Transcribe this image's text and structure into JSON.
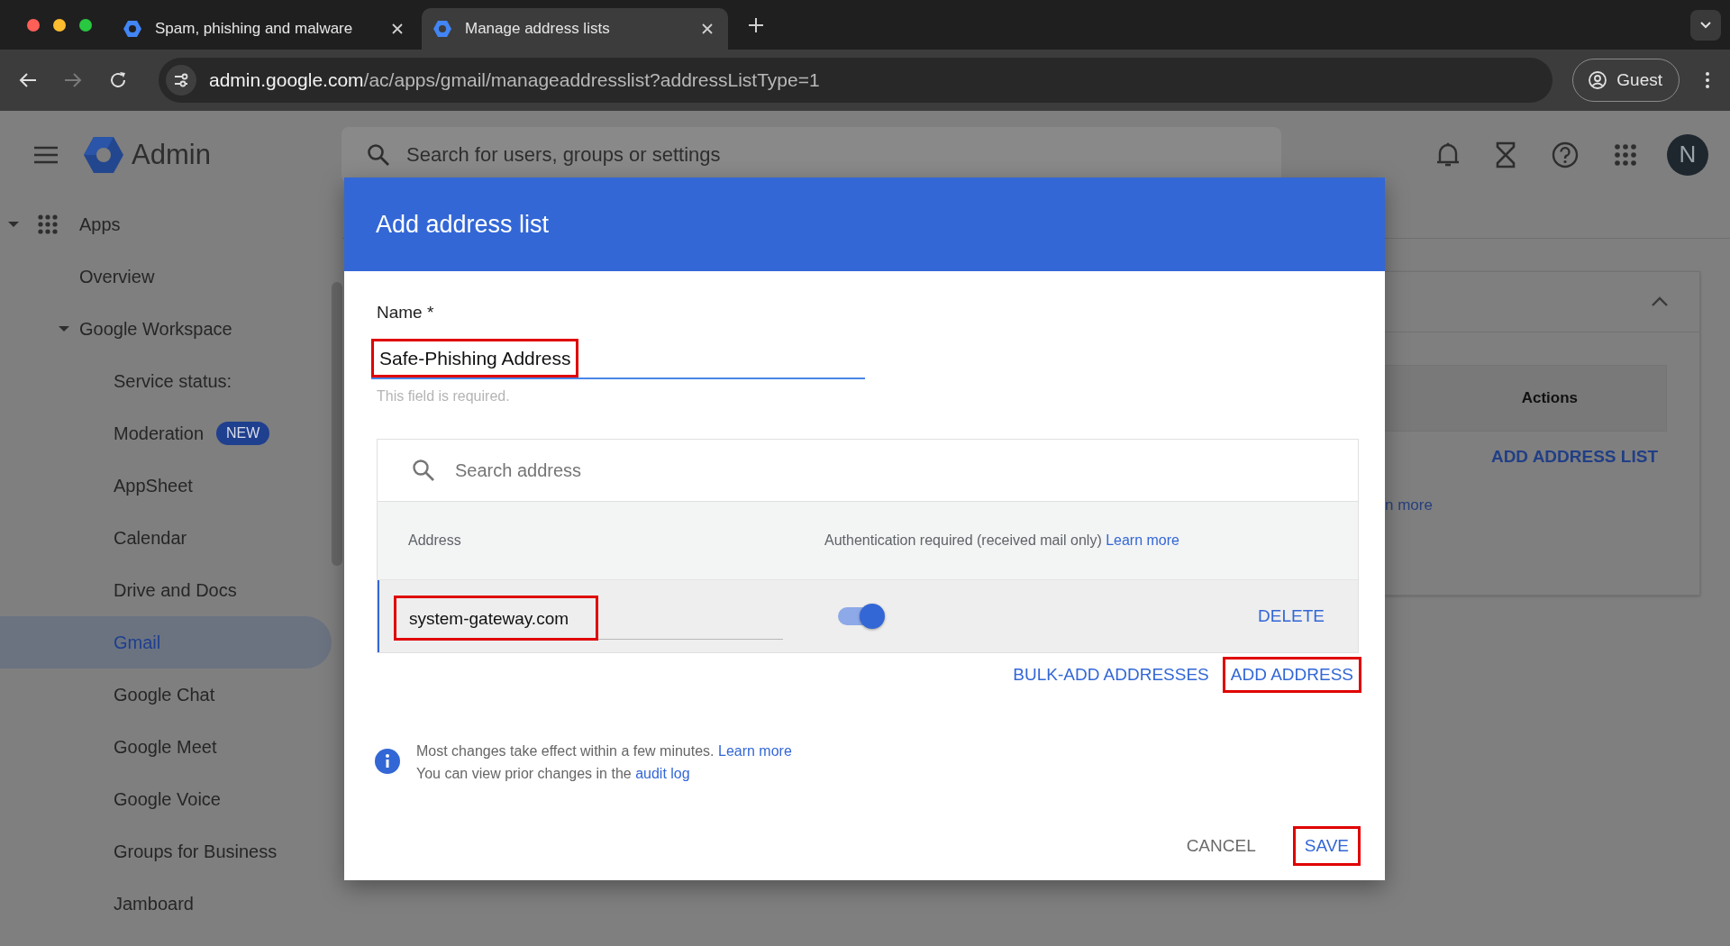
{
  "browser": {
    "tabs": [
      {
        "title": "Spam, phishing and malware",
        "selected": false
      },
      {
        "title": "Manage address lists",
        "selected": true
      }
    ],
    "url_host": "admin.google.com",
    "url_path": "/ac/apps/gmail/manageaddresslist?addressListType=1",
    "profile": "Guest"
  },
  "header": {
    "product": "Admin",
    "search_placeholder": "Search for users, groups or settings",
    "avatar": "N"
  },
  "sidebar": {
    "items": [
      {
        "label": "Apps",
        "expanded": true,
        "selected": false,
        "children": [
          {
            "label": "Overview",
            "selected": false
          },
          {
            "label": "Google Workspace",
            "expanded": true,
            "selected": false,
            "children": [
              {
                "label": "Service status:",
                "selected": false
              },
              {
                "label": "Moderation",
                "badge": "NEW",
                "selected": false
              },
              {
                "label": "AppSheet",
                "selected": false
              },
              {
                "label": "Calendar",
                "selected": false
              },
              {
                "label": "Drive and Docs",
                "selected": false
              },
              {
                "label": "Gmail",
                "selected": true
              },
              {
                "label": "Google Chat",
                "selected": false
              },
              {
                "label": "Google Meet",
                "selected": false
              },
              {
                "label": "Google Voice",
                "selected": false
              },
              {
                "label": "Groups for Business",
                "selected": false
              },
              {
                "label": "Jamboard",
                "selected": false
              }
            ]
          }
        ]
      }
    ]
  },
  "background_card": {
    "column": "Actions",
    "action": "ADD ADDRESS LIST",
    "link": "n more"
  },
  "dialog": {
    "title": "Add address list",
    "name_label": "Name *",
    "name_field": {
      "value": "Safe-Phishing Address",
      "highlighted": true
    },
    "name_hint": "This field is required.",
    "search_placeholder": "Search address",
    "columns": [
      {
        "label": "Address"
      },
      {
        "label": "Authentication required (received mail only)",
        "link": "Learn more"
      }
    ],
    "addresses": [
      {
        "address": "system-gateway.com",
        "highlighted": true,
        "auth_required": true,
        "action": "DELETE"
      }
    ],
    "list_actions": [
      {
        "label": "BULK-ADD ADDRESSES",
        "highlighted": false
      },
      {
        "label": "ADD ADDRESS",
        "highlighted": true
      }
    ],
    "info": [
      {
        "text": "Most changes take effect within a few minutes.",
        "link": "Learn more"
      },
      {
        "text": "You can view prior changes in the",
        "link": "audit log"
      }
    ],
    "buttons": [
      {
        "label": "CANCEL",
        "kind": "secondary",
        "highlighted": false
      },
      {
        "label": "SAVE",
        "kind": "primary",
        "highlighted": true
      }
    ]
  }
}
